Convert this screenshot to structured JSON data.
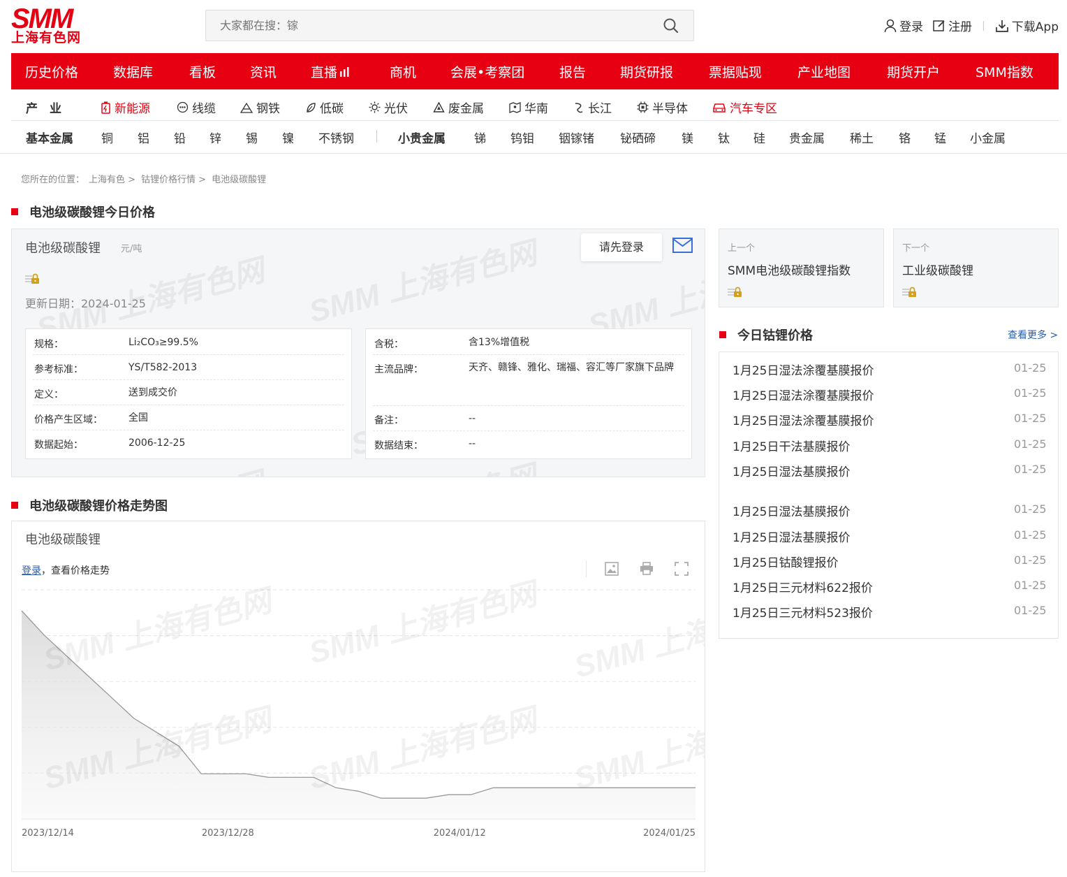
{
  "header": {
    "logo_text": "SMM",
    "logo_sub": "上海有色网",
    "search_placeholder": "大家都在搜：镓",
    "login": "登录",
    "register": "注册",
    "download": "下载App"
  },
  "main_nav": [
    "历史价格",
    "数据库",
    "看板",
    "资讯",
    "直播",
    "商机",
    "会展•考察团",
    "报告",
    "期货研报",
    "票据贴现",
    "产业地图",
    "期货开户",
    "SMM指数"
  ],
  "industry_nav": {
    "label": "产　业",
    "items": [
      {
        "label": "新能源",
        "icon": "battery-icon",
        "highlight": true
      },
      {
        "label": "线缆",
        "icon": "cable-icon",
        "highlight": false
      },
      {
        "label": "钢铁",
        "icon": "steel-icon",
        "highlight": false
      },
      {
        "label": "低碳",
        "icon": "leaf-icon",
        "highlight": false
      },
      {
        "label": "光伏",
        "icon": "sun-icon",
        "highlight": false
      },
      {
        "label": "废金属",
        "icon": "recycle-icon",
        "highlight": false
      },
      {
        "label": "华南",
        "icon": "map-icon",
        "highlight": false
      },
      {
        "label": "长江",
        "icon": "river-icon",
        "highlight": false
      },
      {
        "label": "半导体",
        "icon": "chip-icon",
        "highlight": false
      },
      {
        "label": "汽车专区",
        "icon": "car-icon",
        "highlight": true
      }
    ]
  },
  "metal_nav": {
    "base_label": "基本金属",
    "base": [
      "铜",
      "铝",
      "铅",
      "锌",
      "锡",
      "镍",
      "不锈钢"
    ],
    "minor_label": "小贵金属",
    "minor": [
      "锑",
      "钨钼",
      "铟镓锗",
      "铋硒碲",
      "镁",
      "钛",
      "硅",
      "贵金属",
      "稀土",
      "铬",
      "锰",
      "小金属"
    ]
  },
  "breadcrumb": [
    "您所在的位置：",
    "上海有色 >",
    "钴锂价格行情 >",
    "电池级碳酸锂"
  ],
  "price_section": {
    "title": "电池级碳酸锂今日价格",
    "product": "电池级碳酸锂",
    "unit": "元/吨",
    "login_prompt": "请先登录",
    "updated": "更新日期：2024-01-25",
    "left_rows": [
      {
        "k": "规格：",
        "v": "Li₂CO₃≥99.5%"
      },
      {
        "k": "参考标准：",
        "v": "YS/T582-2013"
      },
      {
        "k": "定义：",
        "v": "送到成交价"
      },
      {
        "k": "价格产生区域：",
        "v": "全国"
      },
      {
        "k": "数据起始：",
        "v": "2006-12-25"
      }
    ],
    "right_rows": [
      {
        "k": "含税：",
        "v": "含13%增值税"
      },
      {
        "k": "主流品牌：",
        "v": "天齐、赣锋、雅化、瑞福、容汇等厂家旗下品牌"
      },
      {
        "k": "备注：",
        "v": "--"
      },
      {
        "k": "数据结束：",
        "v": "--"
      }
    ],
    "watermark": "SMM 上海有色网"
  },
  "chart_section": {
    "title": "电池级碳酸锂价格走势图",
    "chart_title": "电池级碳酸锂",
    "login_link": "登录",
    "login_hint": "，查看价格走势",
    "tools": [
      "image-icon",
      "print-icon",
      "fullscreen-icon"
    ]
  },
  "chart_data": {
    "type": "area",
    "title": "电池级碳酸锂",
    "x_ticks": [
      "2023/12/14",
      "2023/12/28",
      "2024/01/12",
      "2024/01/25"
    ],
    "series": [
      {
        "values": [
          100,
          93,
          87,
          81,
          75,
          69,
          65,
          61,
          53,
          53,
          53,
          52,
          52,
          52,
          49,
          48,
          46,
          46,
          46,
          47,
          47,
          49,
          49,
          49,
          49,
          49,
          49,
          49,
          49,
          49,
          49
        ]
      }
    ],
    "grid": true,
    "color": "#999999"
  },
  "side": {
    "prev": {
      "label": "上一个",
      "name": "SMM电池级碳酸锂指数"
    },
    "next": {
      "label": "下一个",
      "name": "工业级碳酸锂"
    },
    "news_title": "今日钴锂价格",
    "more": "查看更多 >",
    "news": [
      {
        "title": "1月25日湿法涂覆基膜报价",
        "date": "01-25"
      },
      {
        "title": "1月25日湿法涂覆基膜报价",
        "date": "01-25"
      },
      {
        "title": "1月25日湿法涂覆基膜报价",
        "date": "01-25"
      },
      {
        "title": "1月25日干法基膜报价",
        "date": "01-25"
      },
      {
        "title": "1月25日湿法基膜报价",
        "date": "01-25"
      },
      {
        "title": "1月25日湿法基膜报价",
        "date": "01-25"
      },
      {
        "title": "1月25日湿法基膜报价",
        "date": "01-25"
      },
      {
        "title": "1月25日钴酸锂报价",
        "date": "01-25"
      },
      {
        "title": "1月25日三元材料622报价",
        "date": "01-25"
      },
      {
        "title": "1月25日三元材料523报价",
        "date": "01-25"
      }
    ]
  },
  "colors": {
    "brand": "#e60012",
    "link": "#2a5db0"
  }
}
